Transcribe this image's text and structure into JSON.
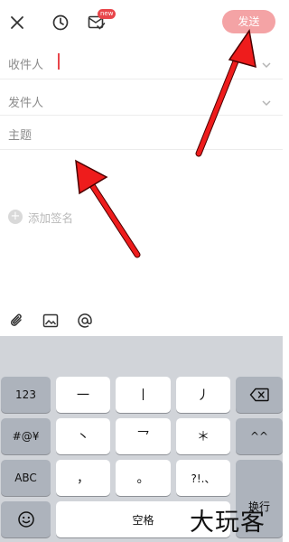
{
  "toolbar": {
    "close_icon": "close-icon",
    "history_icon": "clock-icon",
    "drafts_icon": "mail-check-icon",
    "badge": "new",
    "send_label": "发送",
    "send_color": "#f4a3a5"
  },
  "fields": {
    "to_label": "收件人",
    "from_label": "发件人",
    "subject_label": "主题"
  },
  "signature": {
    "label": "添加签名"
  },
  "attachments": {
    "items": [
      "paperclip-icon",
      "image-icon",
      "at-icon"
    ]
  },
  "keyboard": {
    "row1": [
      "123",
      "一",
      "丨",
      "丿",
      "delete-icon"
    ],
    "row2": [
      "#@¥",
      "丶",
      "乛",
      "＊",
      "^^"
    ],
    "row3": [
      "ABC",
      "，",
      "。",
      "?!.、"
    ],
    "row4": [
      "emoji-icon",
      "空格"
    ],
    "return_label": "换行"
  },
  "watermark": "大玩客",
  "accent_color": "#e8454a"
}
